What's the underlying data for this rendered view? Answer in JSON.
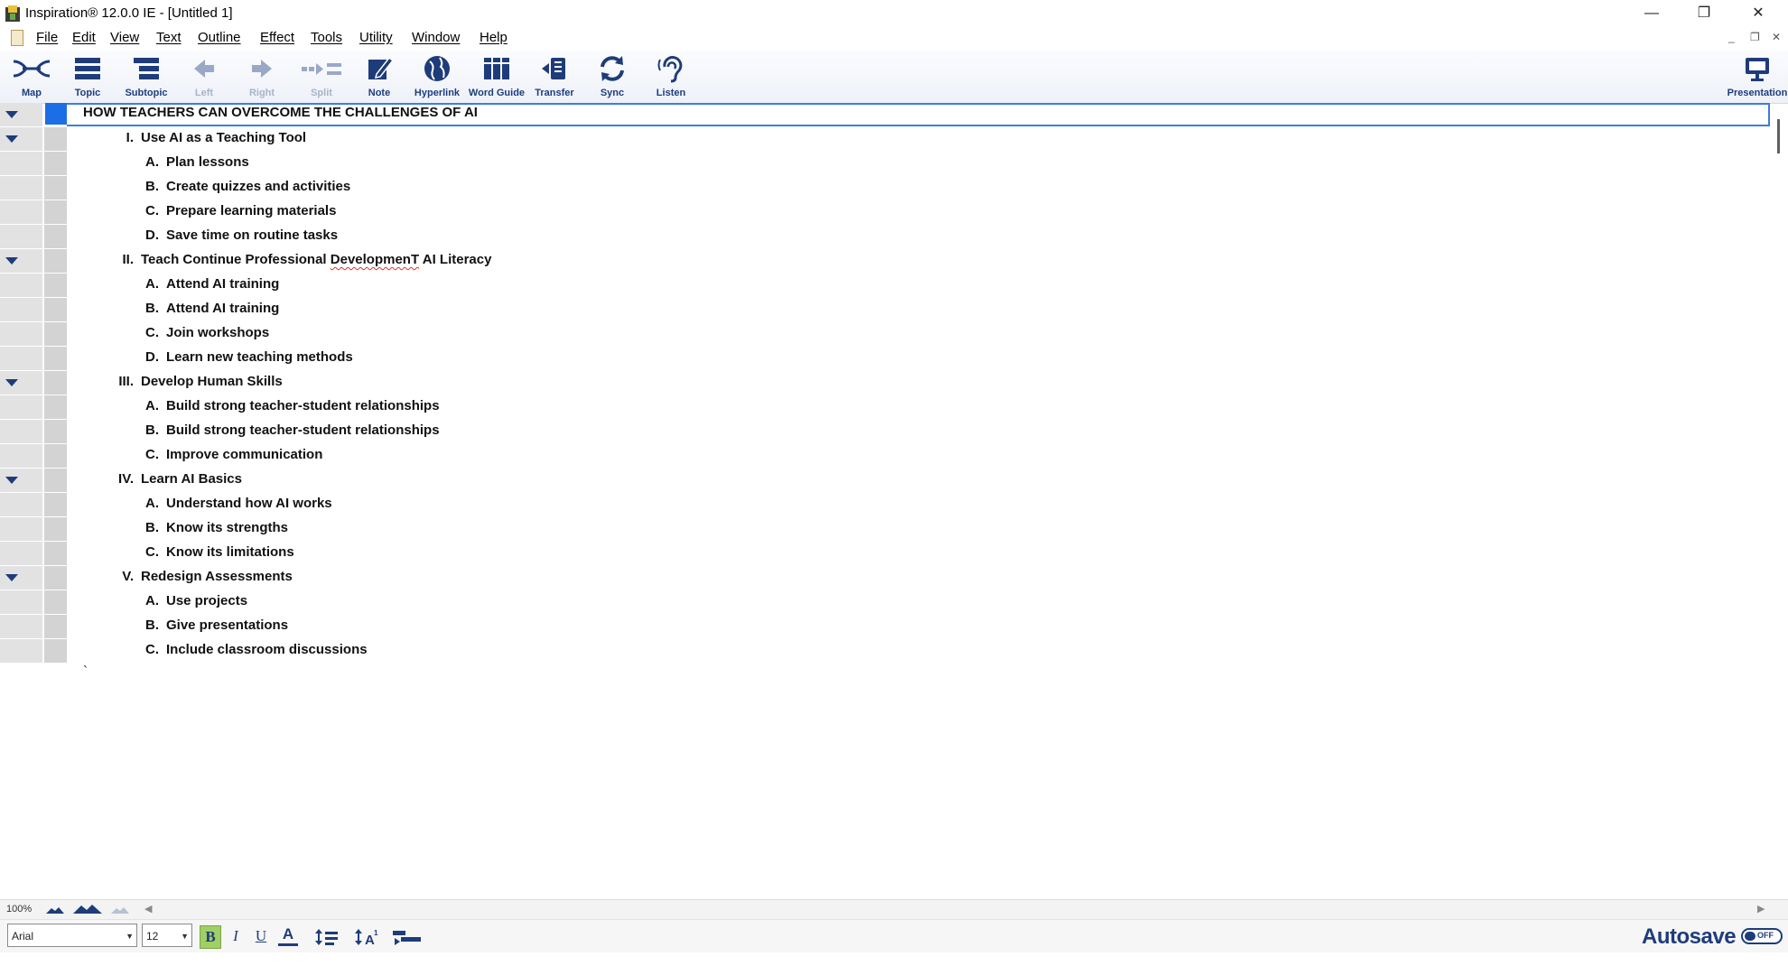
{
  "window": {
    "title": "Inspiration® 12.0.0 IE - [Untitled 1]",
    "minimize": "—",
    "restore": "❐",
    "close": "✕"
  },
  "menu": {
    "items": [
      "File",
      "Edit",
      "View",
      "Text",
      "Outline",
      "Effect",
      "Tools",
      "Utility",
      "Window",
      "Help"
    ],
    "mdi_min": "_",
    "mdi_restore": "❐",
    "mdi_close": "✕"
  },
  "toolbar": {
    "tools": [
      {
        "label": "Map",
        "icon": "map-icon",
        "enabled": true
      },
      {
        "label": "Topic",
        "icon": "topic-icon",
        "enabled": true
      },
      {
        "label": "Subtopic",
        "icon": "subtopic-icon",
        "enabled": true
      },
      {
        "label": "Left",
        "icon": "left-arrow-icon",
        "enabled": false
      },
      {
        "label": "Right",
        "icon": "right-arrow-icon",
        "enabled": false
      },
      {
        "label": "Split",
        "icon": "split-icon",
        "enabled": false
      },
      {
        "label": "Note",
        "icon": "note-icon",
        "enabled": true
      },
      {
        "label": "Hyperlink",
        "icon": "globe-icon",
        "enabled": true
      },
      {
        "label": "Word Guide",
        "icon": "books-icon",
        "enabled": true
      },
      {
        "label": "Transfer",
        "icon": "transfer-icon",
        "enabled": true
      },
      {
        "label": "Sync",
        "icon": "sync-icon",
        "enabled": true
      },
      {
        "label": "Listen",
        "icon": "ear-icon",
        "enabled": true
      }
    ],
    "presentation_label": "Presentation"
  },
  "outline": {
    "title": "HOW TEACHERS CAN OVERCOME THE CHALLENGES OF AI",
    "sections": [
      {
        "num": "I.",
        "text": "Use AI as a Teaching Tool",
        "items": [
          {
            "num": "A.",
            "text": "Plan lessons"
          },
          {
            "num": "B.",
            "text": "Create quizzes and activities"
          },
          {
            "num": "C.",
            "text": "Prepare learning materials"
          },
          {
            "num": "D.",
            "text": "Save time on routine tasks"
          }
        ]
      },
      {
        "num": "II.",
        "text_before": "Teach Continue Professional ",
        "misspelled": "DevelopmenT",
        "text_after": " AI Literacy",
        "items": [
          {
            "num": "A.",
            "text": "Attend AI training"
          },
          {
            "num": "B.",
            "text": "Attend AI training"
          },
          {
            "num": "C.",
            "text": "Join workshops"
          },
          {
            "num": "D.",
            "text": "Learn new teaching methods"
          }
        ]
      },
      {
        "num": "III.",
        "text": "Develop Human Skills",
        "items": [
          {
            "num": "A.",
            "text": "Build strong teacher-student relationships"
          },
          {
            "num": "B.",
            "text": "Build strong teacher-student relationships"
          },
          {
            "num": "C.",
            "text": "Improve communication"
          }
        ]
      },
      {
        "num": "IV.",
        "text": "Learn AI Basics",
        "items": [
          {
            "num": "A.",
            "text": "Understand how AI works"
          },
          {
            "num": "B.",
            "text": "Know its strengths"
          },
          {
            "num": "C.",
            "text": "Know its limitations"
          }
        ]
      },
      {
        "num": "V.",
        "text": "Redesign Assessments",
        "items": [
          {
            "num": "A.",
            "text": "Use projects"
          },
          {
            "num": "B.",
            "text": "Give presentations"
          },
          {
            "num": "C.",
            "text": "Include classroom discussions"
          }
        ]
      }
    ],
    "trailing_mark": "`"
  },
  "zoom": {
    "level": "100%"
  },
  "format": {
    "font": "Arial",
    "size": "12",
    "bold": "B",
    "italic": "I",
    "underline": "U",
    "font_color": "A"
  },
  "autosave": {
    "label": "Autosave",
    "state": "OFF"
  },
  "colors": {
    "accent": "#1e3c7a",
    "selection": "#1c6ee6",
    "bold_active": "#9fcf65"
  }
}
